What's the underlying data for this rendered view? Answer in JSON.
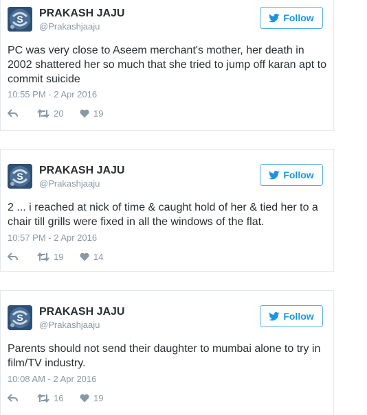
{
  "tweets": [
    {
      "name": "PRAKASH JAJU",
      "handle": "@Prakashjaaju",
      "follow_label": "Follow",
      "text": "PC was very close to Aseem merchant's mother, her death in 2002 shattered her so much that she tried to jump off karan apt to commit suicide",
      "timestamp": "10:55 PM - 2 Apr 2016",
      "retweets": "20",
      "likes": "19"
    },
    {
      "name": "PRAKASH JAJU",
      "handle": "@Prakashjaaju",
      "follow_label": "Follow",
      "text": "2 ... i reached at nick of time & caught hold of her & tied her to a chair till grills were fixed in all the windows of the flat.",
      "timestamp": "10:57 PM - 2 Apr 2016",
      "retweets": "19",
      "likes": "14"
    },
    {
      "name": "PRAKASH JAJU",
      "handle": "@Prakashjaaju",
      "follow_label": "Follow",
      "text": "Parents should not send their daughter to mumbai alone to try in film/TV industry.",
      "timestamp": "10:08 AM - 2 Apr 2016",
      "retweets": "16",
      "likes": "19"
    }
  ],
  "icons": {
    "follow": "twitter-bird-icon",
    "reply": "reply-icon",
    "retweet": "retweet-icon",
    "like": "heart-icon",
    "avatar": "avatar"
  },
  "colors": {
    "accent": "#1b95e0",
    "border": "#e1e8ed",
    "muted": "#8899a6",
    "text": "#292f33"
  }
}
